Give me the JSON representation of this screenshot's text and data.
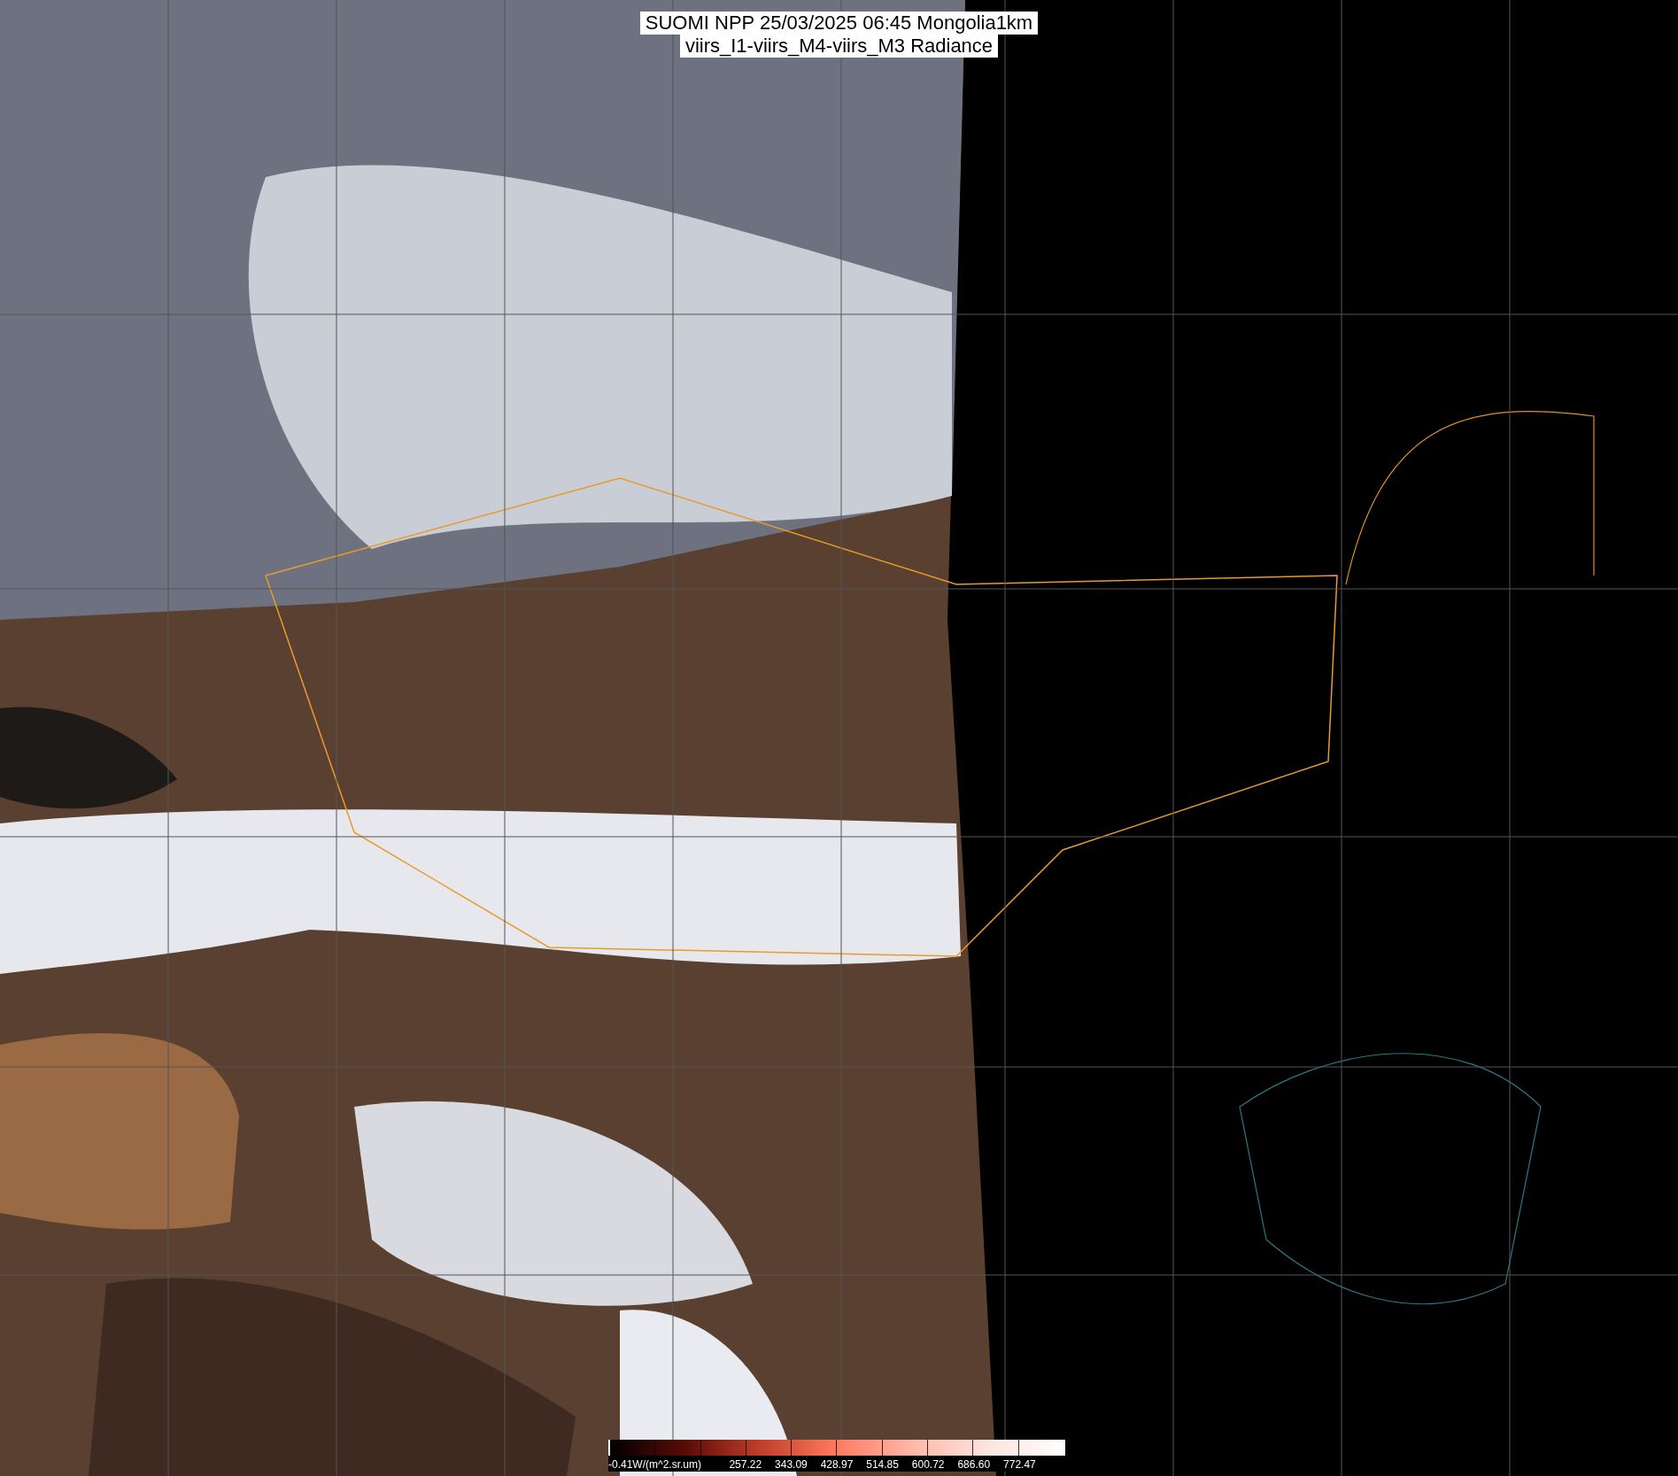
{
  "title": {
    "lines": [
      "SUOMI NPP 25/03/2025 06:45 Mongolia1km",
      "viirs_I1-viirs_M4-viirs_M3 Radiance"
    ]
  },
  "colorbar": {
    "unit_label": "-0.41W/(m^2.sr.um)",
    "tick_labels": [
      "257.22",
      "343.09",
      "428.97",
      "514.85",
      "600.72",
      "686.60",
      "772.47"
    ]
  }
}
